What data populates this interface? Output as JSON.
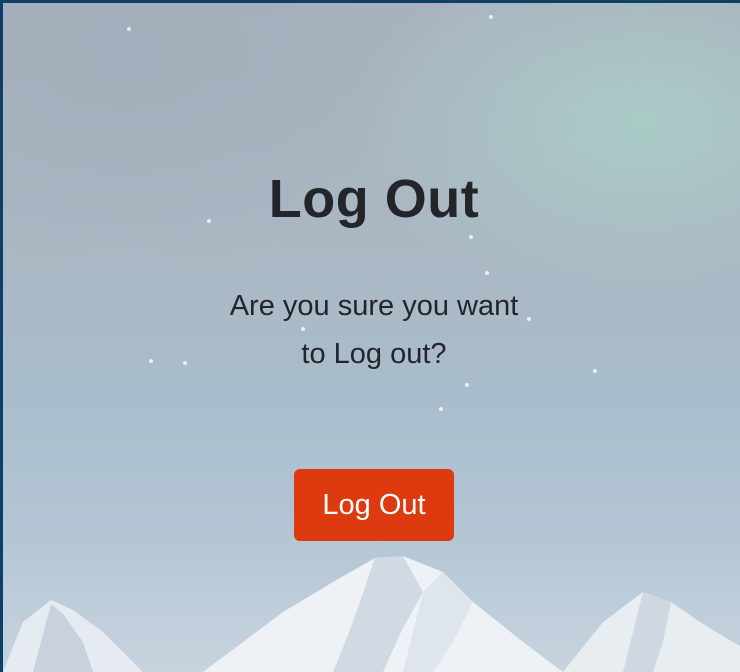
{
  "dialog": {
    "title": "Log Out",
    "message": "Are you sure you want to Log out?",
    "button_label": "Log Out"
  },
  "colors": {
    "button_background": "#dd3a0f",
    "button_text": "#ffffff",
    "text": "#23252b"
  }
}
